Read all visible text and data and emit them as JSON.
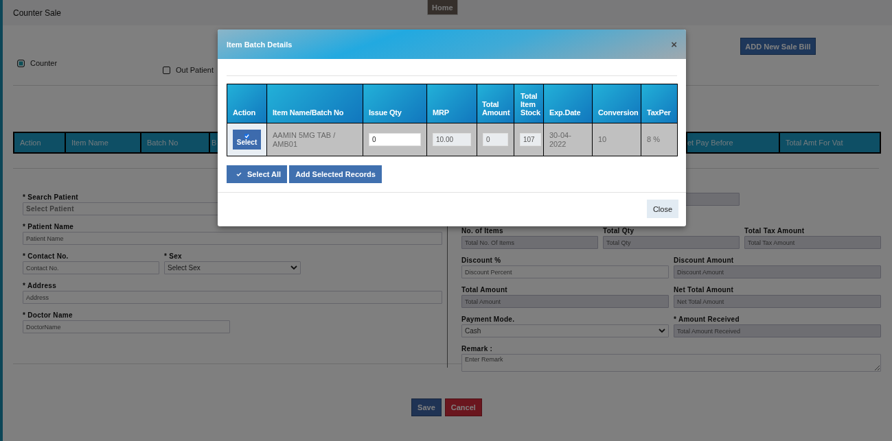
{
  "page": {
    "title": "Counter Sale",
    "home_tab": "Home",
    "add_button": "ADD New Sale Bill",
    "sale_types": [
      {
        "label": "Counter",
        "kind": "radio",
        "checked": true
      },
      {
        "label": "Out Patient",
        "kind": "checkbox",
        "checked": false
      }
    ],
    "items_table": {
      "columns": [
        "Action",
        "Item Name",
        "Batch No",
        "B",
        "et Pay Before",
        "Total Amt For Vat"
      ]
    },
    "patient_form": [
      {
        "label": "* Search Patient",
        "kind": "search-select",
        "value": "Select Patient"
      },
      {
        "label": "* Patient Name",
        "kind": "text",
        "placeholder": "Patient Name"
      },
      {
        "label": "* Contact No.",
        "kind": "text",
        "placeholder": "Contact No."
      },
      {
        "label": "* Sex",
        "kind": "select",
        "value": "Select Sex"
      },
      {
        "label": "* Address",
        "kind": "text",
        "placeholder": "Address"
      },
      {
        "label": "* Doctor Name",
        "kind": "text",
        "placeholder": "DoctorName"
      }
    ],
    "bill_form": [
      {
        "label": "No. of Items",
        "kind": "text",
        "placeholder": "Total No. Of Items",
        "disabled": true
      },
      {
        "label": "Total Qty",
        "kind": "text",
        "placeholder": "Total Qty",
        "disabled": true
      },
      {
        "label": "Total Tax Amount",
        "kind": "text",
        "placeholder": "Total Tax Amount",
        "disabled": true
      },
      {
        "label": "Discount %",
        "kind": "text",
        "placeholder": "Discount Percent",
        "disabled": false
      },
      {
        "label": "Discount Amount",
        "kind": "text",
        "placeholder": "Discount Amount",
        "disabled": true
      },
      {
        "label": "Total Amount",
        "kind": "text",
        "placeholder": "Total Amount",
        "disabled": true
      },
      {
        "label": "Net Total Amount",
        "kind": "text",
        "placeholder": "Net Total Amount",
        "disabled": true
      },
      {
        "label": "Payment Mode.",
        "kind": "select",
        "value": "Cash",
        "disabled": false
      },
      {
        "label": "* Amount Received",
        "kind": "text",
        "placeholder": "Total Amount Received",
        "disabled": true
      },
      {
        "label": "Remark :",
        "kind": "textarea",
        "placeholder": "Enter Remark",
        "disabled": false
      }
    ],
    "buttons": [
      {
        "label": "Save",
        "kind": "primary"
      },
      {
        "label": "Cancel",
        "kind": "danger"
      }
    ]
  },
  "modal": {
    "title": "Item Batch Details",
    "close_icon": "×",
    "table": {
      "columns": [
        "Action",
        "Item Name/Batch No",
        "Issue Qty",
        "MRP",
        "Total Amount",
        "Total Item Stock",
        "Exp.Date",
        "Conversion",
        "TaxPer"
      ],
      "rows": [
        {
          "selected": true,
          "select_label": "Select",
          "item": "AAMIN 5MG TAB / AMB01",
          "issue_qty": "0",
          "mrp": "10.00",
          "total_amount": "0",
          "total_item_stock": "107",
          "exp_date": "30-04-2022",
          "conversion": "10",
          "tax_per": "8 %"
        }
      ]
    },
    "buttons": [
      {
        "label": "Select All",
        "kind": "select-all"
      },
      {
        "label": "Add Selected Records",
        "kind": "add"
      }
    ],
    "close_button": "Close"
  }
}
